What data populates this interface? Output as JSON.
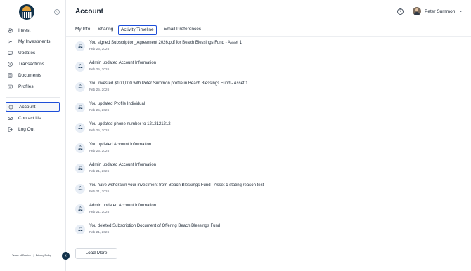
{
  "sidebar": {
    "nav": [
      {
        "label": "Invest",
        "icon": "invest-icon"
      },
      {
        "label": "My Investments",
        "icon": "chart-icon"
      },
      {
        "label": "Updates",
        "icon": "message-icon"
      },
      {
        "label": "Transactions",
        "icon": "dollar-icon"
      },
      {
        "label": "Documents",
        "icon": "document-icon"
      },
      {
        "label": "Profiles",
        "icon": "profile-icon"
      }
    ],
    "account_nav": [
      {
        "label": "Account",
        "icon": "gear-icon",
        "active": true
      },
      {
        "label": "Contact Us",
        "icon": "mail-icon"
      },
      {
        "label": "Log Out",
        "icon": "logout-icon"
      }
    ],
    "footer": {
      "terms": "Terms of Service",
      "separator": "|",
      "privacy": "Privacy Policy"
    }
  },
  "header": {
    "title": "Account",
    "user_name": "Peter Summon"
  },
  "tabs": [
    {
      "label": "My Info"
    },
    {
      "label": "Sharing"
    },
    {
      "label": "Activity Timeline",
      "active": true
    },
    {
      "label": "Email Preferences"
    }
  ],
  "timeline": [
    {
      "text": "You signed Subscription_Agreement 2026.pdf for Beach Blessings Fund - Asset 1",
      "date": "Feb 25, 2026"
    },
    {
      "text": "Admin updated Account Information",
      "date": "Feb 25, 2026"
    },
    {
      "text": "You invested $100,000 with Peter Summon profile in Beach Blessings Fund - Asset 1",
      "date": "Feb 25, 2026"
    },
    {
      "text": "You updated Profile Individual",
      "date": "Feb 25, 2026"
    },
    {
      "text": "You updated phone number to 1212121212",
      "date": "Feb 25, 2026"
    },
    {
      "text": "You updated Account Information",
      "date": "Feb 25, 2026"
    },
    {
      "text": "Admin updated Account Information",
      "date": "Feb 21, 2026"
    },
    {
      "text": "You have withdrawn your investment from Beach Blessings Fund - Asset 1 stating reason test",
      "date": "Feb 21, 2026"
    },
    {
      "text": "Admin updated Account Information",
      "date": "Feb 21, 2026"
    },
    {
      "text": "You deleted Subscription Document of Offering Beach Blessings Fund",
      "date": "Feb 21, 2026"
    }
  ],
  "load_more_label": "Load More",
  "colors": {
    "accent": "#1d4ed8",
    "brand_dark": "#12324a",
    "brand_gold": "#e4a23a",
    "bell_bg": "#e8eef6"
  }
}
